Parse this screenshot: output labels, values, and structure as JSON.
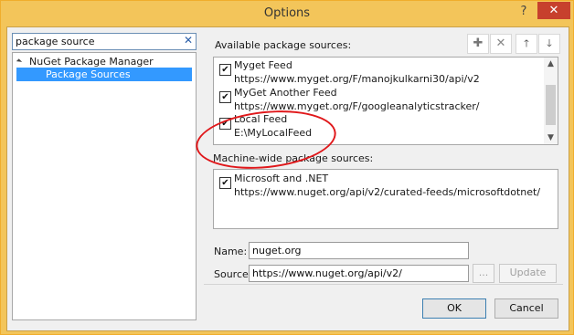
{
  "window": {
    "title": "Options",
    "help_label": "?",
    "close_label": "✕"
  },
  "search": {
    "value": "package source",
    "clear_label": "✕"
  },
  "tree": {
    "parent_label": "NuGet Package Manager",
    "child_label": "Package Sources"
  },
  "available": {
    "label": "Available package sources:",
    "items": [
      {
        "name": "Myget Feed",
        "url": "https://www.myget.org/F/manojkulkarni30/api/v2",
        "checked": true
      },
      {
        "name": "MyGet Another Feed",
        "url": "https://www.myget.org/F/googleanalyticstracker/",
        "checked": true
      },
      {
        "name": "Local Feed",
        "url": "E:\\MyLocalFeed",
        "checked": true
      }
    ]
  },
  "machine_wide": {
    "label": "Machine-wide package sources:",
    "items": [
      {
        "name": "Microsoft and .NET",
        "url": "https://www.nuget.org/api/v2/curated-feeds/microsoftdotnet/",
        "checked": true
      }
    ]
  },
  "form": {
    "name_label": "Name:",
    "name_value": "nuget.org",
    "source_label": "Source:",
    "source_value": "https://www.nuget.org/api/v2/",
    "browse_label": "...",
    "update_label": "Update"
  },
  "toolbar": {
    "add_icon": "plus-icon",
    "remove_icon": "x-icon",
    "up_icon": "arrow-up-icon",
    "down_icon": "arrow-down-icon"
  },
  "footer": {
    "ok_label": "OK",
    "cancel_label": "Cancel"
  },
  "colors": {
    "title_bar": "#f3c55a",
    "close_button": "#c7402d",
    "selection": "#3399ff",
    "annotation": "#e0181b"
  }
}
